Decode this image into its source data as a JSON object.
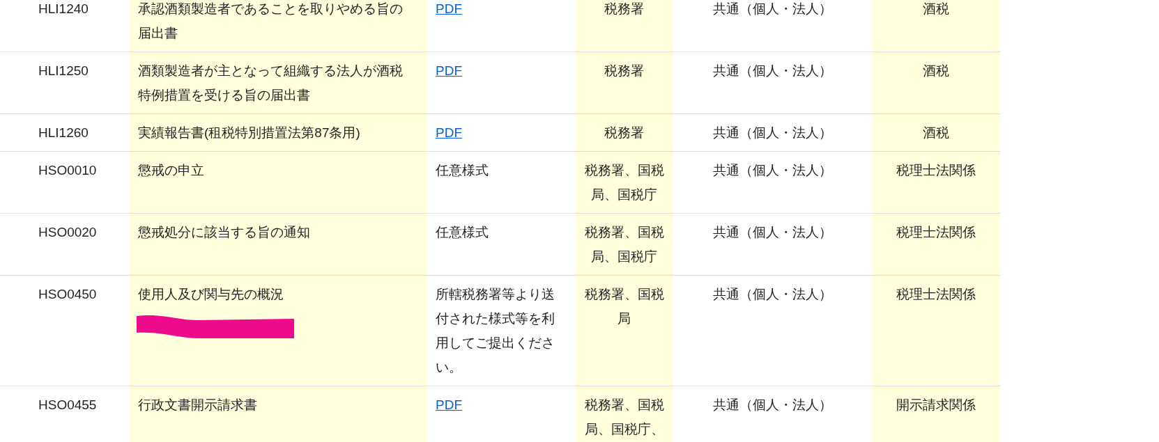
{
  "table": {
    "rows": [
      {
        "code": "HLI1240",
        "name": "承認酒類製造者であることを取りやめる旨の届出書",
        "form": {
          "kind": "link",
          "text": "PDF"
        },
        "office": "税務署",
        "target": "共通（個人・法人）",
        "category": "酒税"
      },
      {
        "code": "HLI1250",
        "name": "酒類製造者が主となって組織する法人が酒税特例措置を受ける旨の届出書",
        "form": {
          "kind": "link",
          "text": "PDF"
        },
        "office": "税務署",
        "target": "共通（個人・法人）",
        "category": "酒税"
      },
      {
        "code": "HLI1260",
        "name": "実績報告書(租税特別措置法第87条用)",
        "form": {
          "kind": "link",
          "text": "PDF"
        },
        "office": "税務署",
        "target": "共通（個人・法人）",
        "category": "酒税"
      },
      {
        "code": "HSO0010",
        "name": "懲戒の申立",
        "form": {
          "kind": "text",
          "text": "任意様式"
        },
        "office": "税務署、国税局、国税庁",
        "target": "共通（個人・法人）",
        "category": "税理士法関係"
      },
      {
        "code": "HSO0020",
        "name": "懲戒処分に該当する旨の通知",
        "form": {
          "kind": "text",
          "text": "任意様式"
        },
        "office": "税務署、国税局、国税庁",
        "target": "共通（個人・法人）",
        "category": "税理士法関係"
      },
      {
        "code": "HSO0450",
        "name": "使用人及び関与先の概況",
        "form": {
          "kind": "text",
          "text": "所轄税務署等より送付された様式等を利用してご提出ください。"
        },
        "office": "税務署、国税局",
        "target": "共通（個人・法人）",
        "category": "税理士法関係"
      },
      {
        "code": "HSO0455",
        "name": "行政文書開示請求書",
        "form": {
          "kind": "link",
          "text": "PDF"
        },
        "office": "税務署、国税局、国税庁、",
        "target": "共通（個人・法人）",
        "category": "開示請求関係"
      }
    ]
  }
}
